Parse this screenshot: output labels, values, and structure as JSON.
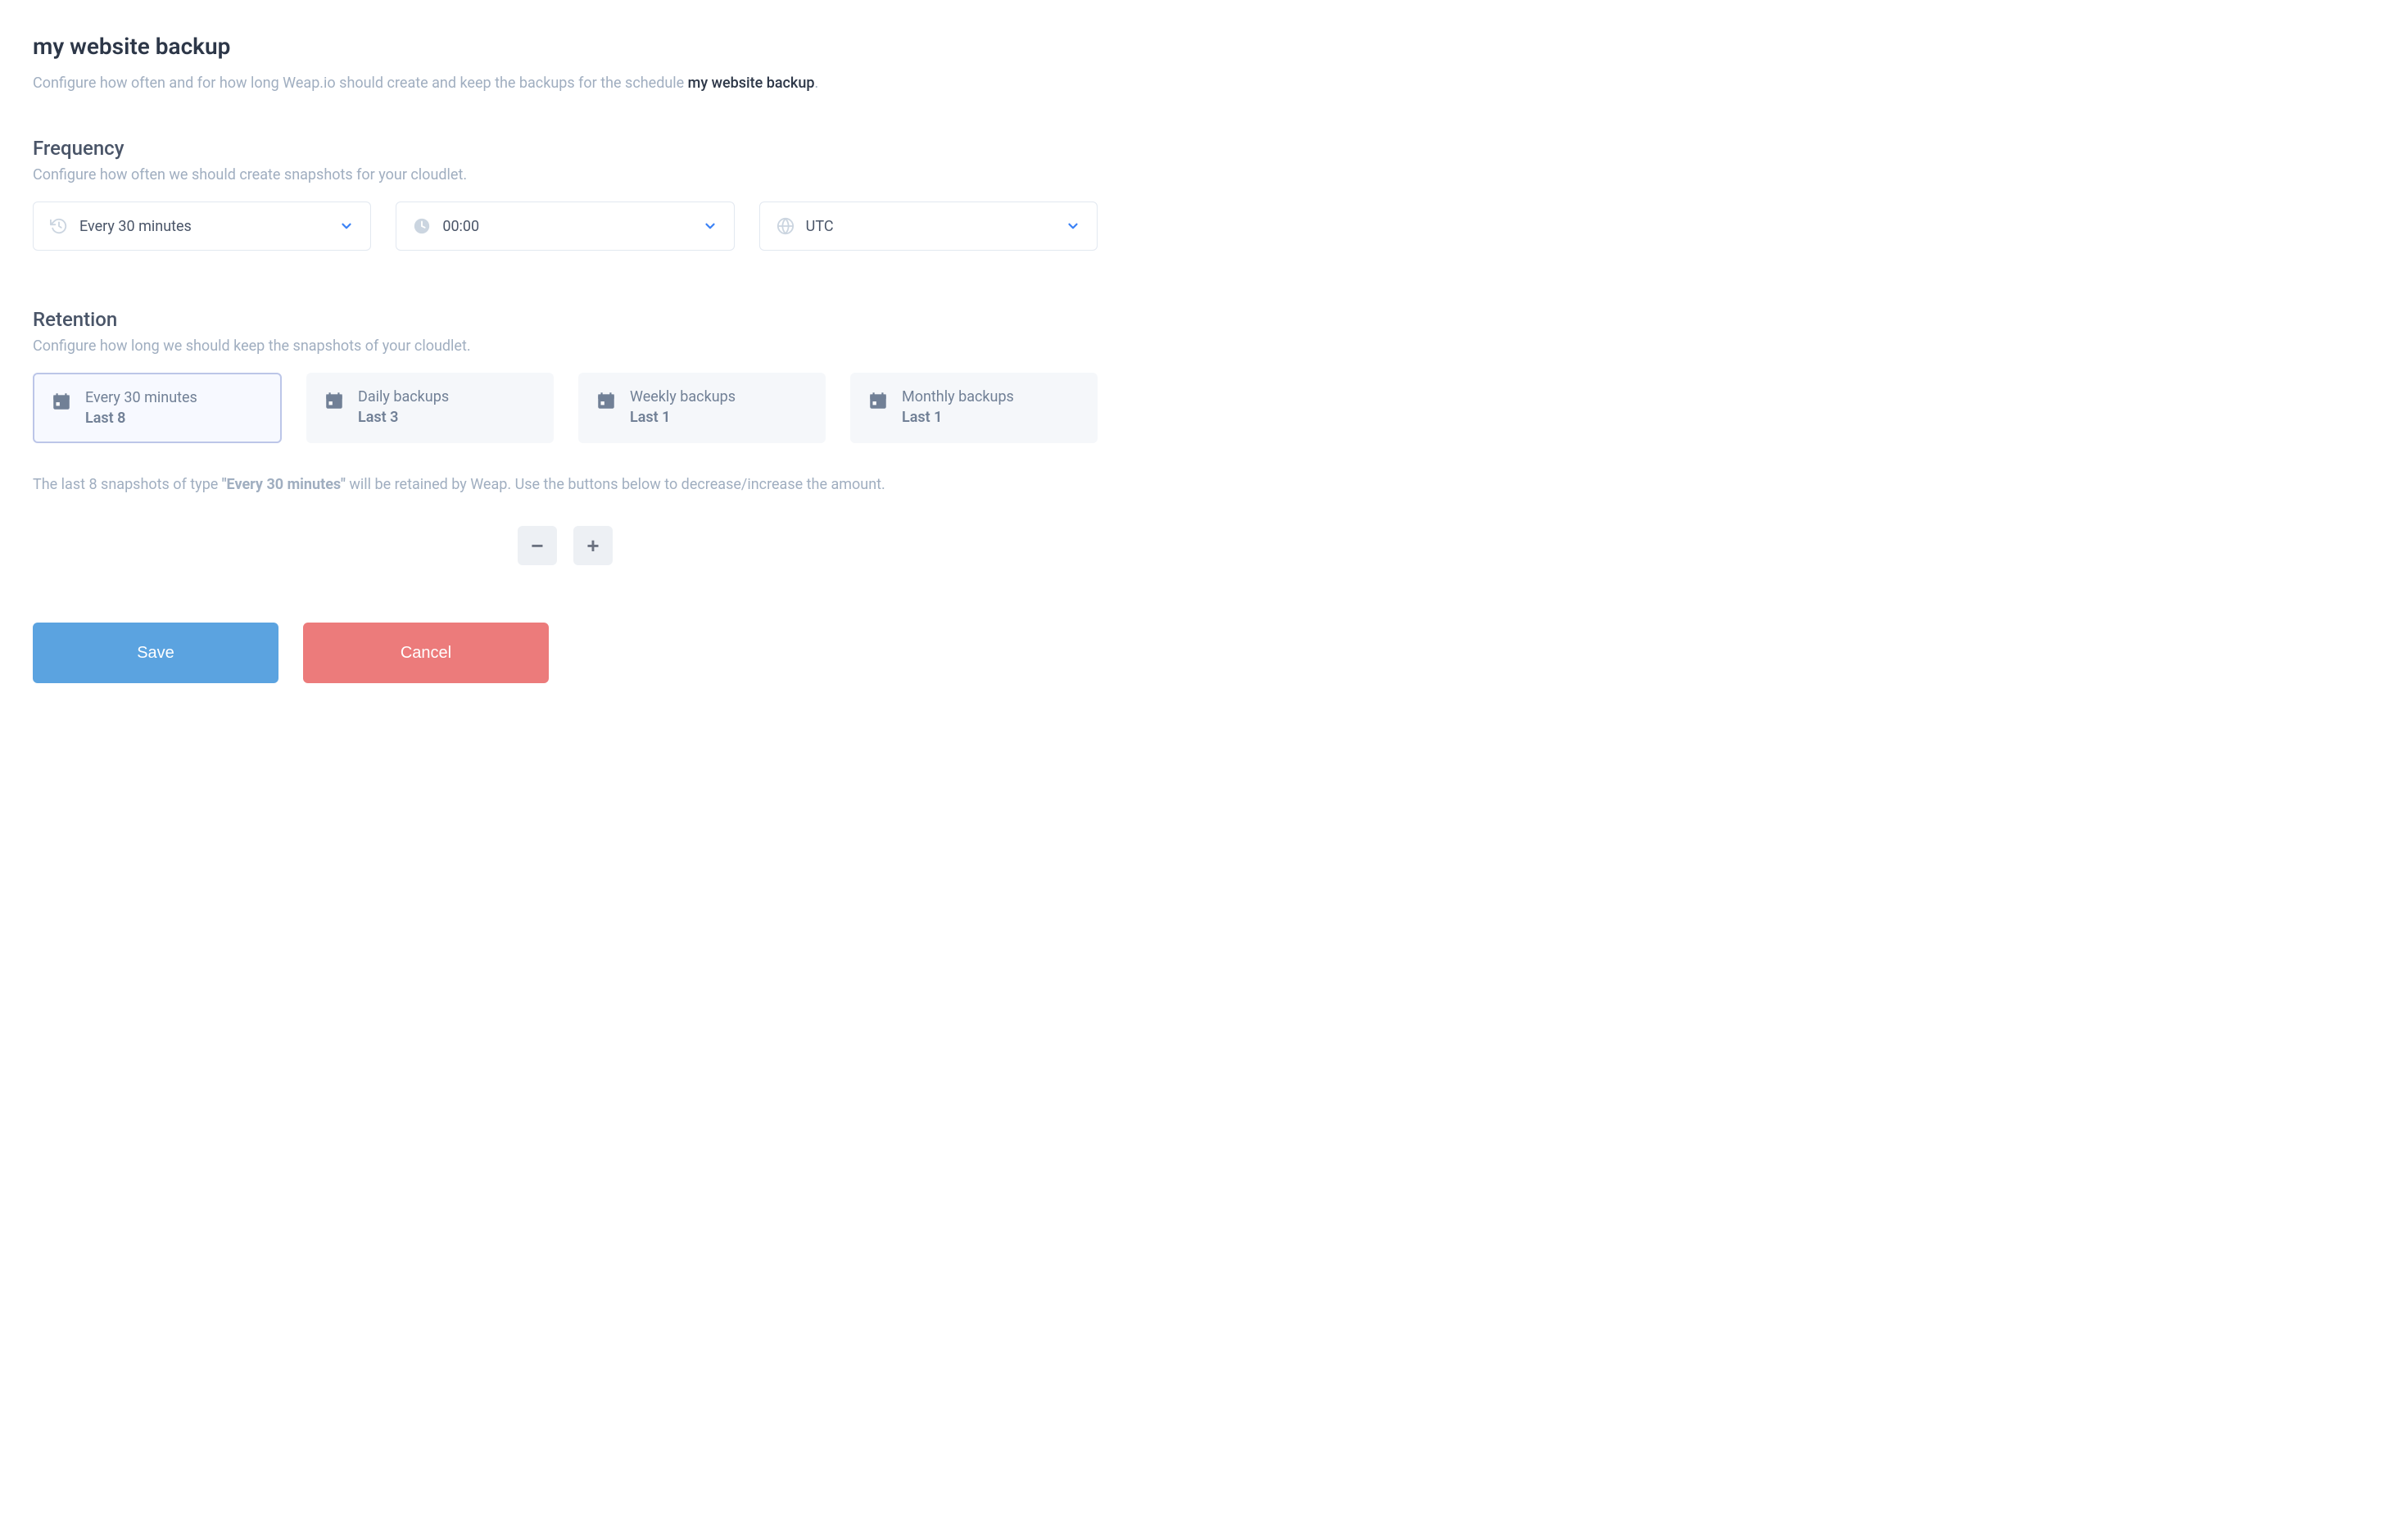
{
  "header": {
    "title": "my website backup",
    "desc_prefix": "Configure how often and for how long Weap.io should create and keep the backups for the schedule ",
    "desc_schedule_name": "my website backup",
    "desc_suffix": "."
  },
  "frequency": {
    "title": "Frequency",
    "desc": "Configure how often we should create snapshots for your cloudlet.",
    "interval": "Every 30 minutes",
    "time": "00:00",
    "timezone": "UTC"
  },
  "retention": {
    "title": "Retention",
    "desc": "Configure how long we should keep the snapshots of your cloudlet.",
    "cards": [
      {
        "name": "Every 30 minutes",
        "last": "Last 8",
        "active": true
      },
      {
        "name": "Daily backups",
        "last": "Last 3",
        "active": false
      },
      {
        "name": "Weekly backups",
        "last": "Last 1",
        "active": false
      },
      {
        "name": "Monthly backups",
        "last": "Last 1",
        "active": false
      }
    ],
    "message_prefix": "The last 8 snapshots of type ",
    "message_emph": "\"Every 30 minutes\"",
    "message_suffix": " will be retained by Weap. Use the buttons below to decrease/increase the amount."
  },
  "actions": {
    "save": "Save",
    "cancel": "Cancel"
  }
}
